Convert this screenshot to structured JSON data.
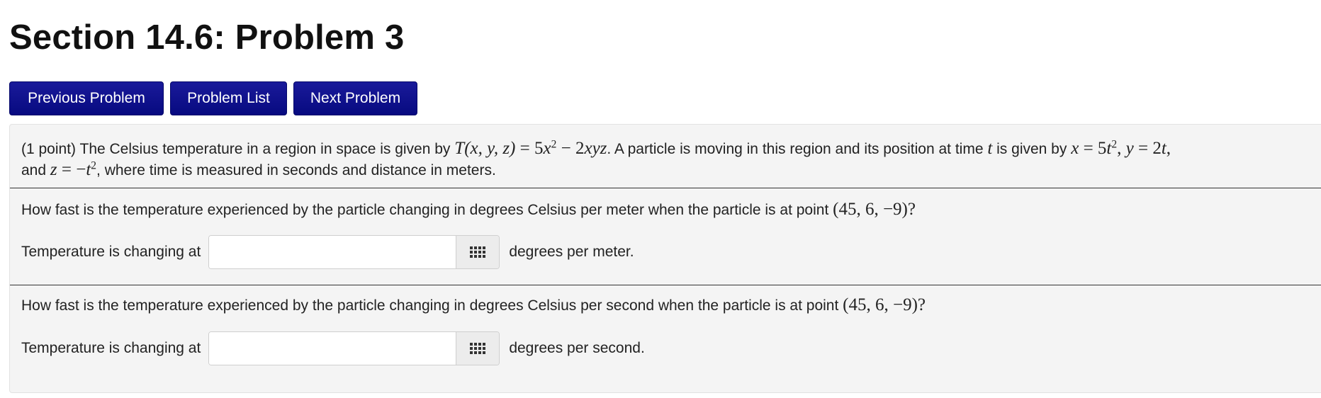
{
  "page": {
    "title": "Section 14.6: Problem 3"
  },
  "nav": {
    "previous_label": "Previous Problem",
    "list_label": "Problem List",
    "next_label": "Next Problem"
  },
  "problem": {
    "intro_prefix": "(1 point) The Celsius temperature in a region in space is given by",
    "intro_middle": ". A particle is moving in this region and its position at time",
    "intro_middle2": "is given by",
    "intro_line2_prefix": "and",
    "intro_line2_suffix": ", where time is measured in seconds and distance in meters.",
    "math": {
      "T_name": "T",
      "T_args": "(x, y, z)",
      "eq": "=",
      "coef_a": "5",
      "var_x": "x",
      "exp_2": "2",
      "minus": "−",
      "coef_b": "2",
      "xyz": "xyz",
      "t": "t",
      "x": "x",
      "x_val": "5",
      "y": "y",
      "y_val": "2",
      "z": "z",
      "z_val": "−",
      "comma": ","
    },
    "questions": [
      {
        "text": "How fast is the temperature experienced by the particle changing in degrees Celsius per meter when the particle is at point",
        "point": "(45, 6, −9)",
        "end": "?",
        "answer_label": "Temperature is changing at",
        "answer_value": "",
        "unit": "degrees per meter."
      },
      {
        "text": "How fast is the temperature experienced by the particle changing in degrees Celsius per second when the particle is at point",
        "point": "(45, 6, −9)",
        "end": "?",
        "answer_label": "Temperature is changing at",
        "answer_value": "",
        "unit": "degrees per second."
      }
    ]
  },
  "icons": {
    "keypad": "keypad-grid-icon"
  },
  "colors": {
    "button_bg": "#0b0f8a",
    "button_text": "#ffffff",
    "panel_bg": "#f4f4f4",
    "title_text": "#111111"
  }
}
